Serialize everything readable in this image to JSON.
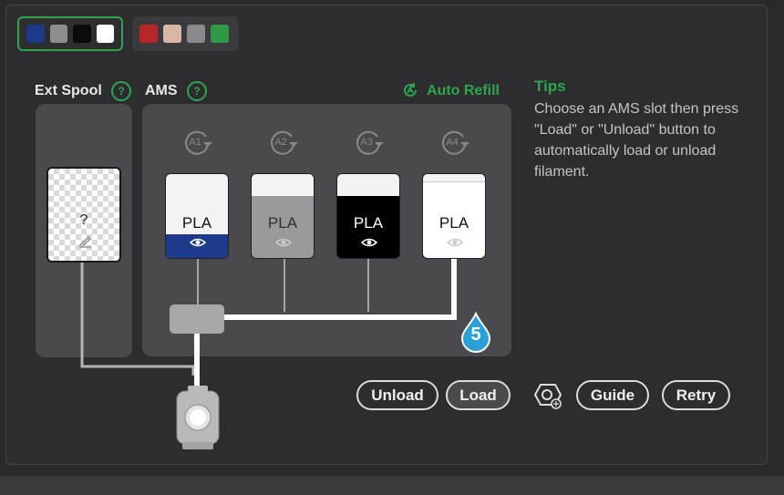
{
  "ams_groups": [
    {
      "selected": true,
      "colors": [
        "#1e3a8a",
        "#8d8d90",
        "#0b0b0b",
        "#ffffff"
      ]
    },
    {
      "selected": false,
      "colors": [
        "#b82727",
        "#d7b8a5",
        "#8a8a8c",
        "#2f9a45"
      ]
    }
  ],
  "labels": {
    "ext_spool": "Ext Spool",
    "ams": "AMS",
    "help": "?",
    "auto_refill": "Auto Refill"
  },
  "ext_spool": {
    "mark": "?"
  },
  "slots": [
    {
      "id": "A1",
      "material": "PLA",
      "color": "#1e3a8a"
    },
    {
      "id": "A2",
      "material": "PLA",
      "color": "#9a9a9c"
    },
    {
      "id": "A3",
      "material": "PLA",
      "color": "#000000"
    },
    {
      "id": "A4",
      "material": "PLA",
      "color": "#ffffff"
    }
  ],
  "humidity_level": "5",
  "tips": {
    "title": "Tips",
    "text": "Choose an AMS slot then press \"Load\" or \"Unload\" button to automatically load or unload filament."
  },
  "buttons": {
    "unload": "Unload",
    "load": "Load",
    "guide": "Guide",
    "retry": "Retry"
  },
  "icons": {
    "help": "question-icon",
    "auto_refill": "auto-refill-icon",
    "slot_rotate": "rotate-arrow-icon",
    "humidity": "water-drop-icon",
    "nozzle": "nozzle-settings-icon",
    "extruder": "extruder-icon"
  }
}
